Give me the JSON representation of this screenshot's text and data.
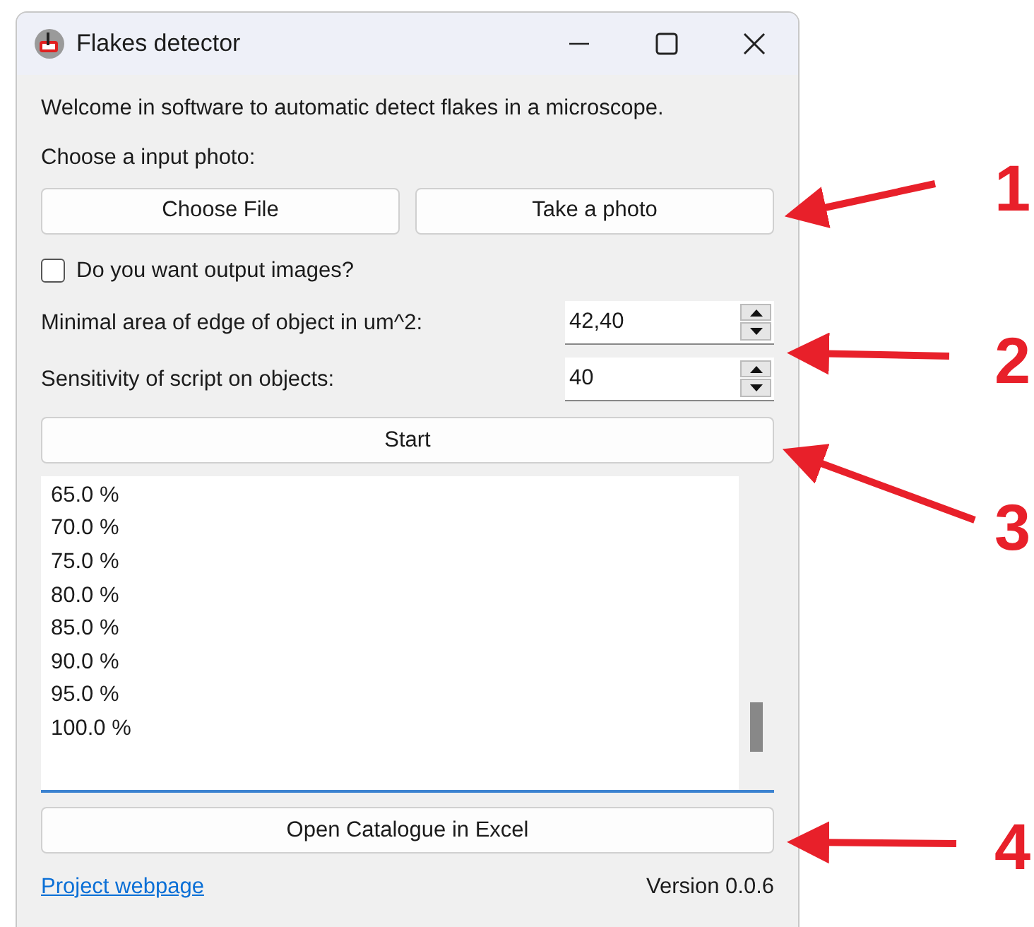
{
  "window": {
    "title": "Flakes detector"
  },
  "welcome": "Welcome in software to automatic detect flakes in a microscope.",
  "input_label": "Choose a input photo:",
  "input_buttons": [
    "Choose File",
    "Take a photo"
  ],
  "output_checkbox": {
    "label": "Do you want output images?",
    "checked": false
  },
  "fields": [
    {
      "label": "Minimal area of edge of object in um^2:",
      "value": "42,40"
    },
    {
      "label": "Sensitivity of script on objects:",
      "value": "40"
    }
  ],
  "start_button": "Start",
  "log": [
    "65.0 %",
    "70.0 %",
    "75.0 %",
    "80.0 %",
    "85.0 %",
    "90.0 %",
    "95.0 %",
    "100.0 %"
  ],
  "excel_button": "Open Catalogue in Excel",
  "footer": {
    "link": "Project webpage",
    "version": "Version 0.0.6"
  },
  "annotations": [
    {
      "label": "1"
    },
    {
      "label": "2"
    },
    {
      "label": "3"
    },
    {
      "label": "4"
    }
  ]
}
